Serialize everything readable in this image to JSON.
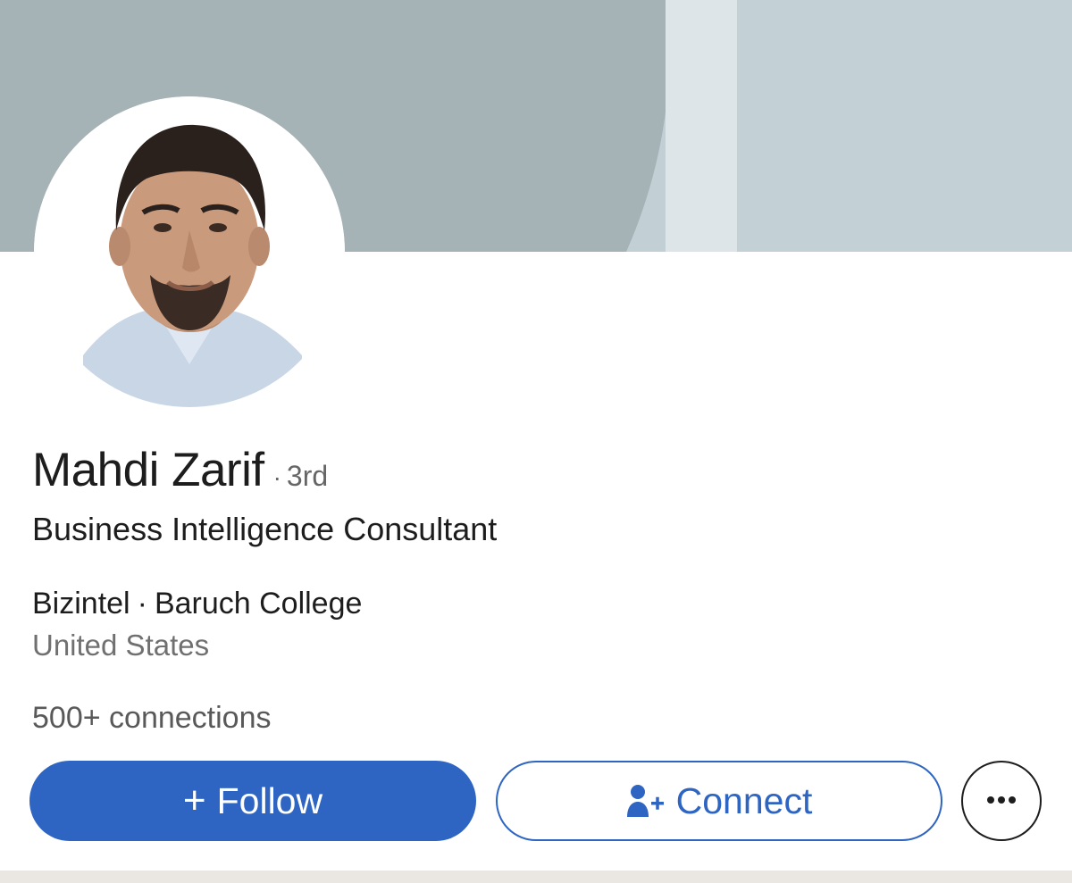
{
  "profile": {
    "name": "Mahdi Zarif",
    "degree_separator": "·",
    "degree": "3rd",
    "headline": "Business Intelligence Consultant",
    "company": "Bizintel",
    "org_separator": "·",
    "school": "Baruch College",
    "location": "United States",
    "connections": "500+ connections"
  },
  "actions": {
    "follow_plus": "+",
    "follow_label": "Follow",
    "connect_label": "Connect",
    "more_icon": "ellipsis-icon"
  },
  "colors": {
    "accent": "#2f65c2",
    "banner_dark": "#a5b2b6",
    "banner_light": "#c2d0d6"
  }
}
